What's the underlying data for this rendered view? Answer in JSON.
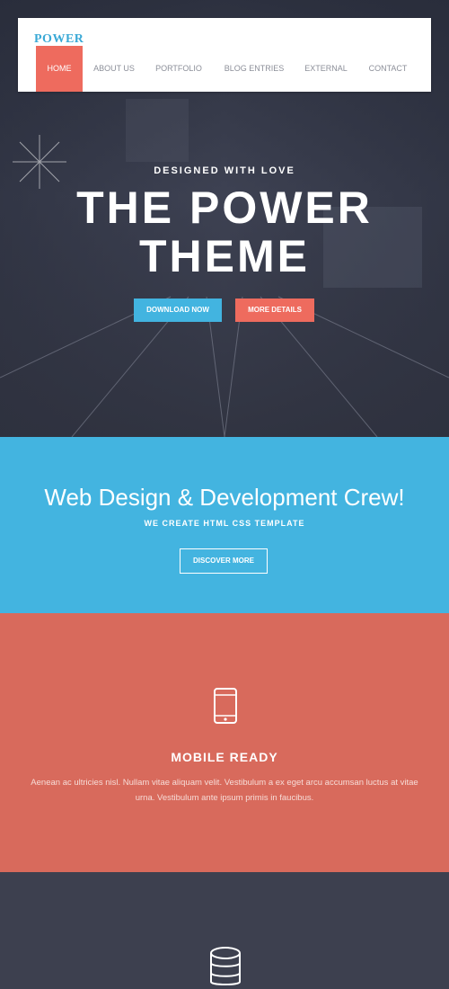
{
  "nav": {
    "logo": "POWER",
    "items": [
      {
        "label": "HOME",
        "active": true
      },
      {
        "label": "ABOUT US",
        "active": false
      },
      {
        "label": "PORTFOLIO",
        "active": false
      },
      {
        "label": "BLOG ENTRIES",
        "active": false
      },
      {
        "label": "EXTERNAL",
        "active": false
      },
      {
        "label": "CONTACT",
        "active": false
      }
    ]
  },
  "hero": {
    "subtitle": "DESIGNED WITH LOVE",
    "title_line1": "THE POWER",
    "title_line2": "THEME",
    "download_label": "DOWNLOAD NOW",
    "details_label": "MORE DETAILS"
  },
  "crew": {
    "title": "Web Design & Development Crew!",
    "subtitle": "WE CREATE HTML CSS TEMPLATE",
    "discover_label": "DISCOVER MORE"
  },
  "feature": {
    "icon": "mobile-icon",
    "title": "MOBILE READY",
    "text": "Aenean ac ultricies nisl. Nullam vitae aliquam velit. Vestibulum a ex eget arcu accumsan luctus at vitae urna. Vestibulum ante ipsum primis in faucibus."
  },
  "bottom": {
    "icon": "database-icon"
  },
  "colors": {
    "accent_red": "#ee6b5e",
    "accent_blue": "#42b4e0",
    "dark": "#3b3e4d"
  }
}
